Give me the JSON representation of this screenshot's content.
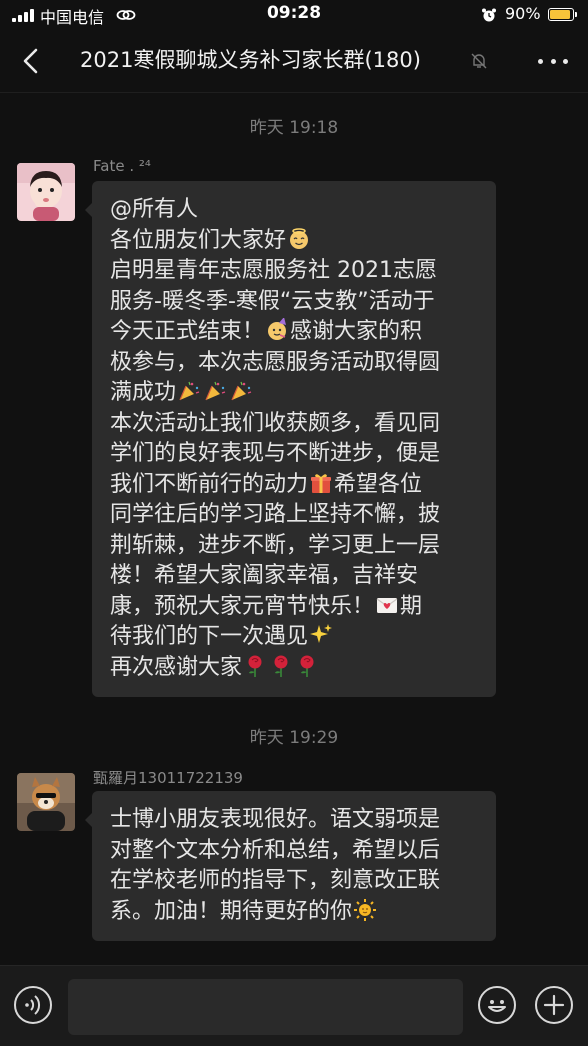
{
  "status_bar": {
    "carrier": "中国电信",
    "time": "09:28",
    "battery_percent_text": "90%",
    "battery_level": 0.9
  },
  "nav": {
    "title": "2021寒假聊城义务补习家长群(180)",
    "back_icon": "chevron-left-icon",
    "mute_icon": "bell-slash-icon",
    "more_icon": "more-horizontal-icon"
  },
  "messages": [
    {
      "timestamp": "昨天 19:18",
      "sender": "Fate . ²⁴",
      "avatar_icon": "child-photo-avatar",
      "lines": [
        [
          {
            "t": "@所有人"
          }
        ],
        [
          {
            "t": "各位朋友们大家好"
          },
          {
            "e": "angel"
          }
        ],
        [
          {
            "t": "启明星青年志愿服务社 2021志愿"
          }
        ],
        [
          {
            "t": "服务-暖冬季-寒假“云支教”活动于"
          }
        ],
        [
          {
            "t": "今天正式结束！"
          },
          {
            "e": "party-face"
          },
          {
            "t": "感谢大家的积"
          }
        ],
        [
          {
            "t": "极参与，本次志愿服务活动取得圆"
          }
        ],
        [
          {
            "t": "满成功"
          },
          {
            "e": "party-popper"
          },
          {
            "e": "party-popper"
          },
          {
            "e": "party-popper"
          }
        ],
        [
          {
            "t": "本次活动让我们收获颇多，看见同"
          }
        ],
        [
          {
            "t": "学们的良好表现与不断进步，便是"
          }
        ],
        [
          {
            "t": "我们不断前行的动力"
          },
          {
            "e": "gift"
          },
          {
            "t": "希望各位"
          }
        ],
        [
          {
            "t": "同学往后的学习路上坚持不懈，披"
          }
        ],
        [
          {
            "t": "荆斩棘，进步不断，学习更上一层"
          }
        ],
        [
          {
            "t": "楼！希望大家阖家幸福，吉祥安"
          }
        ],
        [
          {
            "t": "康，预祝大家元宵节快乐！"
          },
          {
            "e": "love-letter"
          },
          {
            "t": "期"
          }
        ],
        [
          {
            "t": "待我们的下一次遇见"
          },
          {
            "e": "sparkles"
          }
        ],
        [
          {
            "t": "再次感谢大家"
          },
          {
            "e": "rose"
          },
          {
            "e": "rose"
          },
          {
            "e": "rose"
          }
        ]
      ]
    },
    {
      "timestamp": "昨天 19:29",
      "sender": "甄羅月13011722139",
      "avatar_icon": "dog-photo-avatar",
      "lines": [
        [
          {
            "t": "士博小朋友表现很好。语文弱项是"
          }
        ],
        [
          {
            "t": "对整个文本分析和总结，希望以后"
          }
        ],
        [
          {
            "t": "在学校老师的指导下，刻意改正联"
          }
        ],
        [
          {
            "t": "系。加油！期待更好的你"
          },
          {
            "e": "sun"
          }
        ]
      ]
    }
  ],
  "input_bar": {
    "voice_icon": "voice-icon",
    "input_value": "",
    "emoji_icon": "smiley-icon",
    "plus_icon": "plus-icon"
  },
  "colors": {
    "background": "#111111",
    "bubble": "#2c2c2c",
    "text": "#e6e6e6",
    "meta": "#7c7c7c",
    "battery": "#f7c43a"
  }
}
